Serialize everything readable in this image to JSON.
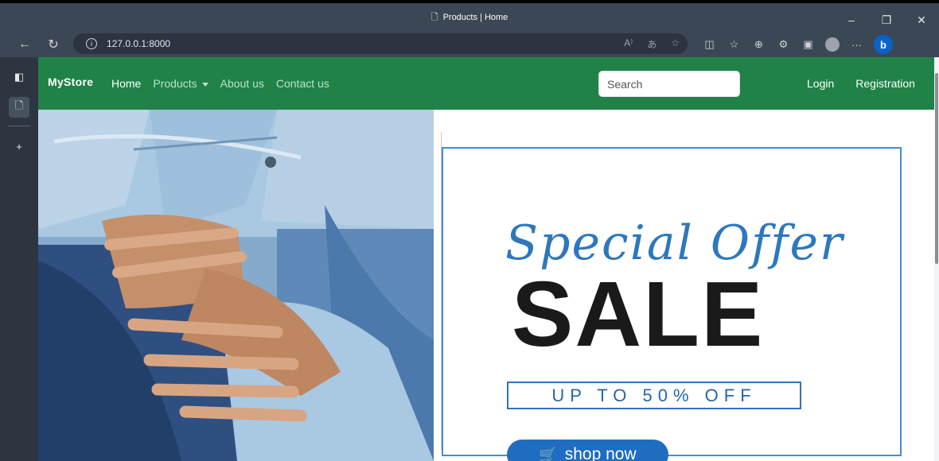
{
  "browser": {
    "tab_title": "Products | Home",
    "url": "127.0.0.1:8000",
    "window_controls": [
      "–",
      "❐",
      "✕"
    ],
    "toolbar_icons": [
      "read-aloud-icon",
      "translate-icon",
      "favorite-star-icon",
      "split-screen-icon",
      "favorites-icon",
      "collections-icon",
      "extensions-icon",
      "browser-essentials-icon",
      "profile-avatar-icon",
      "more-icon",
      "bing-copilot-icon"
    ],
    "more_label": "···"
  },
  "sidebar": {
    "icons": [
      "tab-actions-icon",
      "page-tab-icon",
      "new-tab-plus-icon"
    ]
  },
  "site": {
    "brand": "MyStore",
    "nav": [
      {
        "label": "Home",
        "active": true
      },
      {
        "label": "Products",
        "active": false,
        "dropdown": true
      },
      {
        "label": "About us",
        "active": false
      },
      {
        "label": "Contact us",
        "active": false
      }
    ],
    "search_placeholder": "Search",
    "login": "Login",
    "registration": "Registration",
    "colors": {
      "navbar": "#208247",
      "accent_blue": "#1f6dc1"
    }
  },
  "promo": {
    "headline": "Special Offer",
    "sale": "SALE",
    "discount": "UP TO 50% OFF",
    "cta": "shop now"
  }
}
